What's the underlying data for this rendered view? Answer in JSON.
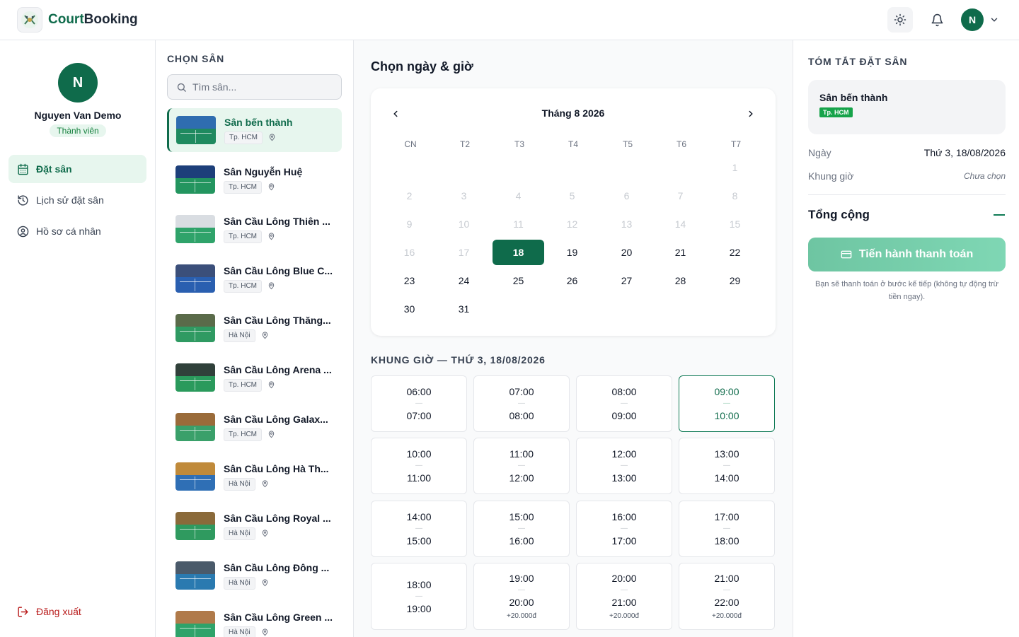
{
  "app": {
    "brand_part1": "Court",
    "brand_part2": "Booking",
    "avatar_initial": "N"
  },
  "user": {
    "initial": "N",
    "name": "Nguyen Van Demo",
    "role": "Thành viên"
  },
  "nav": {
    "book": "Đặt sân",
    "history": "Lịch sử đặt sân",
    "profile": "Hồ sơ cá nhân",
    "logout": "Đăng xuất"
  },
  "courts": {
    "title": "CHỌN SÂN",
    "search_placeholder": "Tìm sân...",
    "items": [
      {
        "name": "Sân bến thành",
        "city": "Tp. HCM"
      },
      {
        "name": "Sân Nguyễn Huệ",
        "city": "Tp. HCM"
      },
      {
        "name": "Sân Cầu Lông Thiên ...",
        "city": "Tp. HCM"
      },
      {
        "name": "Sân Cầu Lông Blue C...",
        "city": "Tp. HCM"
      },
      {
        "name": "Sân Cầu Lông Thăng...",
        "city": "Hà Nội"
      },
      {
        "name": "Sân Cầu Lông Arena ...",
        "city": "Tp. HCM"
      },
      {
        "name": "Sân Cầu Lông Galax...",
        "city": "Tp. HCM"
      },
      {
        "name": "Sân Cầu Lông Hà Th...",
        "city": "Hà Nội"
      },
      {
        "name": "Sân Cầu Lông Royal ...",
        "city": "Hà Nội"
      },
      {
        "name": "Sân Cầu Lông Đông ...",
        "city": "Hà Nội"
      },
      {
        "name": "Sân Cầu Lông Green ...",
        "city": "Hà Nội"
      }
    ]
  },
  "calendar": {
    "title": "Chọn ngày & giờ",
    "month_label": "Tháng 8 2026",
    "weekdays": [
      "CN",
      "T2",
      "T3",
      "T4",
      "T5",
      "T6",
      "T7"
    ],
    "first_weekday_index": 6,
    "days_in_month": 31,
    "selected_day": 18
  },
  "slots": {
    "title": "KHUNG GIỜ — THỨ 3, 18/08/2026",
    "dash": "—",
    "items": [
      {
        "start": "06:00",
        "end": "07:00"
      },
      {
        "start": "07:00",
        "end": "08:00"
      },
      {
        "start": "08:00",
        "end": "09:00"
      },
      {
        "start": "09:00",
        "end": "10:00",
        "selected": true
      },
      {
        "start": "10:00",
        "end": "11:00"
      },
      {
        "start": "11:00",
        "end": "12:00"
      },
      {
        "start": "12:00",
        "end": "13:00"
      },
      {
        "start": "13:00",
        "end": "14:00"
      },
      {
        "start": "14:00",
        "end": "15:00"
      },
      {
        "start": "15:00",
        "end": "16:00"
      },
      {
        "start": "16:00",
        "end": "17:00"
      },
      {
        "start": "17:00",
        "end": "18:00"
      },
      {
        "start": "18:00",
        "end": "19:00"
      },
      {
        "start": "19:00",
        "end": "20:00",
        "price": "+20.000đ"
      },
      {
        "start": "20:00",
        "end": "21:00",
        "price": "+20.000đ"
      },
      {
        "start": "21:00",
        "end": "22:00",
        "price": "+20.000đ"
      }
    ]
  },
  "summary": {
    "title": "TÓM TẮT ĐẶT SÂN",
    "court_name": "Sân bến thành",
    "court_city": "Tp. HCM",
    "date_label": "Ngày",
    "date_value": "Thứ 3, 18/08/2026",
    "slot_label": "Khung giờ",
    "slot_value": "Chưa chọn",
    "total_label": "Tổng cộng",
    "pay_button": "Tiến hành thanh toán",
    "pay_note": "Bạn sẽ thanh toán ở bước kế tiếp (không tự động trừ tiền ngay)."
  },
  "colors": {
    "primary": "#0f6b4b",
    "accent_light": "#e7f6ee",
    "danger": "#b91c1c"
  }
}
